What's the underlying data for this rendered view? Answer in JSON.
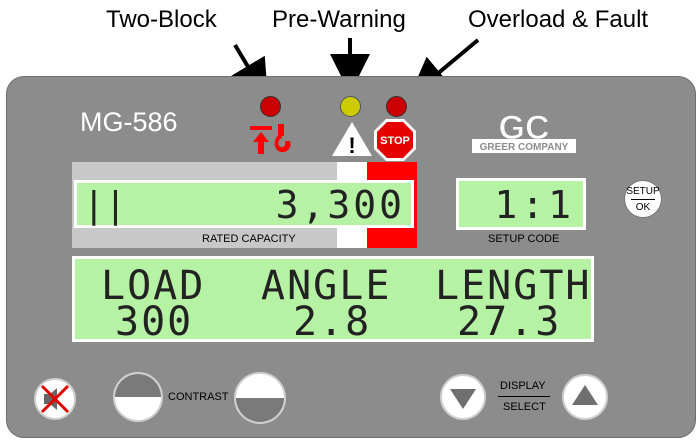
{
  "callouts": {
    "two_block": "Two-Block",
    "pre_warning": "Pre-Warning",
    "overload_fault": "Overload & Fault"
  },
  "panel": {
    "model": "MG-586",
    "brand_top": "GC",
    "brand_bottom": "GREER COMPANY",
    "stop_text": "STOP",
    "warning_symbol": "!"
  },
  "indicators": [
    {
      "name": "two-block",
      "color": "#cc0000",
      "icon": "two-block-icon"
    },
    {
      "name": "pre-warning",
      "color": "#cccc00",
      "icon": "warning-triangle-icon"
    },
    {
      "name": "overload-fault",
      "color": "#cc0000",
      "icon": "stop-sign-icon"
    }
  ],
  "rated_capacity": {
    "mode_symbol": "||",
    "value": "3,300",
    "label": "RATED CAPACITY"
  },
  "setup_code": {
    "value": "1:1",
    "label": "SETUP CODE"
  },
  "main_display": {
    "headers": [
      "LOAD",
      "ANGLE",
      "LENGTH"
    ],
    "values": [
      "300",
      "2.8",
      "27.3"
    ]
  },
  "buttons": {
    "setup_top": "SETUP",
    "setup_bottom": "OK",
    "contrast_label": "CONTRAST",
    "display_top": "DISPLAY",
    "display_bottom": "SELECT"
  },
  "colors": {
    "lcd": "#b6f2a4",
    "panel": "#8c8c8c",
    "alarm_red": "#ff0000",
    "led_red": "#cc0000",
    "led_yellow": "#cccc00"
  }
}
